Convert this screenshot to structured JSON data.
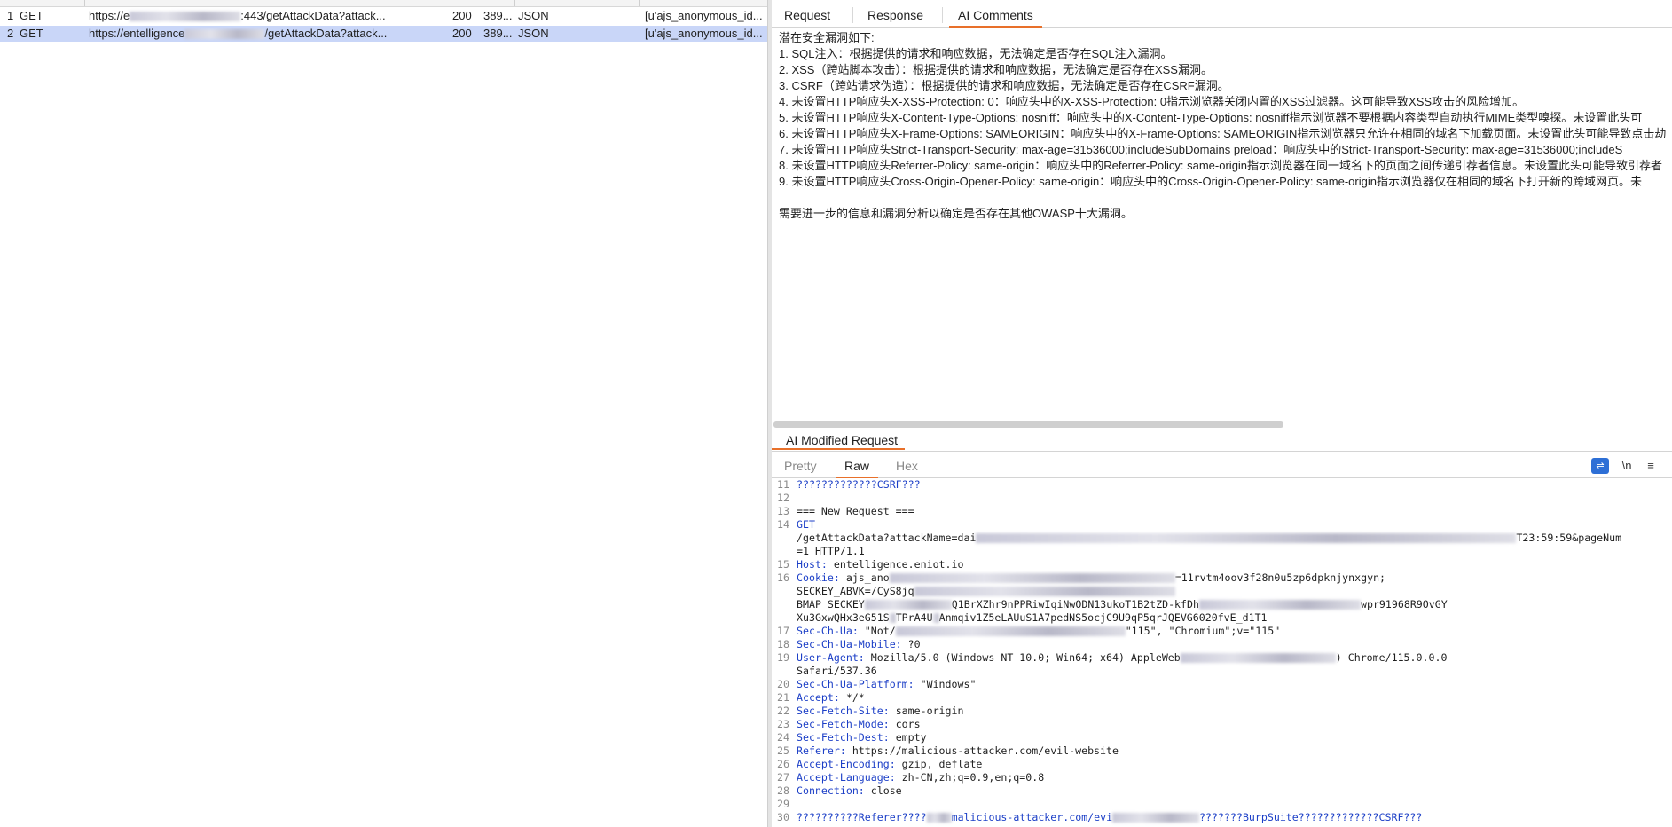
{
  "table": {
    "rows": [
      {
        "num": "1",
        "method": "GET",
        "url_prefix": "https://e",
        "url_suffix": ":443/getAttackData?attack...",
        "status": "200",
        "length": "389...",
        "mime": "JSON",
        "cookie": "[u'ajs_anonymous_id..."
      },
      {
        "num": "2",
        "method": "GET",
        "url_prefix": "https://entelligence",
        "url_suffix": "/getAttackData?attack...",
        "status": "200",
        "length": "389...",
        "mime": "JSON",
        "cookie": "[u'ajs_anonymous_id..."
      }
    ]
  },
  "right_tabs": [
    "Request",
    "Response",
    "AI Comments"
  ],
  "active_tab": "AI Comments",
  "ai_comments": {
    "lines": [
      "潜在安全漏洞如下:",
      "1. SQL注入：根据提供的请求和响应数据，无法确定是否存在SQL注入漏洞。",
      "2. XSS（跨站脚本攻击）：根据提供的请求和响应数据，无法确定是否存在XSS漏洞。",
      "3. CSRF（跨站请求伪造）：根据提供的请求和响应数据，无法确定是否存在CSRF漏洞。",
      "4. 未设置HTTP响应头X-XSS-Protection: 0：响应头中的X-XSS-Protection: 0指示浏览器关闭内置的XSS过滤器。这可能导致XSS攻击的风险增加。",
      "5. 未设置HTTP响应头X-Content-Type-Options: nosniff：响应头中的X-Content-Type-Options: nosniff指示浏览器不要根据内容类型自动执行MIME类型嗅探。未设置此头可",
      "6. 未设置HTTP响应头X-Frame-Options: SAMEORIGIN：响应头中的X-Frame-Options: SAMEORIGIN指示浏览器只允许在相同的域名下加载页面。未设置此头可能导致点击劫",
      "7. 未设置HTTP响应头Strict-Transport-Security: max-age=31536000;includeSubDomains preload：响应头中的Strict-Transport-Security: max-age=31536000;includeS",
      "8. 未设置HTTP响应头Referrer-Policy: same-origin：响应头中的Referrer-Policy: same-origin指示浏览器在同一域名下的页面之间传递引荐者信息。未设置此头可能导致引荐者",
      "9. 未设置HTTP响应头Cross-Origin-Opener-Policy: same-origin：响应头中的Cross-Origin-Opener-Policy: same-origin指示浏览器仅在相同的域名下打开新的跨域网页。未",
      "",
      "需要进一步的信息和漏洞分析以确定是否存在其他OWASP十大漏洞。"
    ]
  },
  "modified_request": {
    "title": "AI Modified Request",
    "subtabs": [
      "Pretty",
      "Raw",
      "Hex"
    ],
    "active_subtab": "Raw",
    "tools": [
      "wrap-icon",
      "\\n",
      "≡"
    ],
    "lines": [
      {
        "n": "11",
        "parts": [
          {
            "c": "q",
            "t": "?????????????CSRF???"
          }
        ]
      },
      {
        "n": "12",
        "parts": []
      },
      {
        "n": "13",
        "parts": [
          {
            "c": "txt",
            "t": "=== New Request ==="
          }
        ]
      },
      {
        "n": "14",
        "parts": [
          {
            "c": "kw",
            "t": "GET"
          }
        ]
      },
      {
        "n": "",
        "parts": [
          {
            "c": "txt",
            "t": "/getAttackData?attackName=dai"
          },
          {
            "c": "blur",
            "t": "                                                                                       "
          },
          {
            "c": "txt",
            "t": "T23:59:59&pageNum"
          }
        ]
      },
      {
        "n": "",
        "parts": [
          {
            "c": "txt",
            "t": "=1 HTTP/1.1"
          }
        ]
      },
      {
        "n": "15",
        "parts": [
          {
            "c": "kw",
            "t": "Host: "
          },
          {
            "c": "txt",
            "t": "entelligence.eniot.io"
          }
        ]
      },
      {
        "n": "16",
        "parts": [
          {
            "c": "kw",
            "t": "Cookie: "
          },
          {
            "c": "txt",
            "t": "ajs_ano"
          },
          {
            "c": "blur",
            "t": "                                              "
          },
          {
            "c": "txt",
            "t": "=11rvtm4oov3f28n0u5zp6dpknjynxgyn;"
          }
        ]
      },
      {
        "n": "",
        "parts": [
          {
            "c": "txt",
            "t": "SECKEY_ABVK=/CyS8jq"
          },
          {
            "c": "blur",
            "t": "                                          "
          }
        ]
      },
      {
        "n": "",
        "parts": [
          {
            "c": "txt",
            "t": "BMAP_SECKEY"
          },
          {
            "c": "blur",
            "t": "              "
          },
          {
            "c": "txt",
            "t": "Q1BrXZhr9nPPRiwIqiNwODN13ukoT1B2tZD-kfDh"
          },
          {
            "c": "blur",
            "t": "                          "
          },
          {
            "c": "txt",
            "t": "wpr91968R9OvGY"
          }
        ]
      },
      {
        "n": "",
        "parts": [
          {
            "c": "txt",
            "t": "Xu3GxwQHx3eG51S"
          },
          {
            "c": "blur",
            "t": " "
          },
          {
            "c": "txt",
            "t": "TPrA4U"
          },
          {
            "c": "blur",
            "t": " "
          },
          {
            "c": "txt",
            "t": "Anmqiv1Z5eLAUuS1A7pedNS5ocjC9U9qP5qrJQEVG6020fvE_d1T1"
          }
        ]
      },
      {
        "n": "17",
        "parts": [
          {
            "c": "kw",
            "t": "Sec-Ch-Ua: "
          },
          {
            "c": "txt",
            "t": "\"Not/"
          },
          {
            "c": "blur",
            "t": "                                     "
          },
          {
            "c": "txt",
            "t": "\"115\", \"Chromium\";v=\"115\""
          }
        ]
      },
      {
        "n": "18",
        "parts": [
          {
            "c": "kw",
            "t": "Sec-Ch-Ua-Mobile: "
          },
          {
            "c": "txt",
            "t": "?0"
          }
        ]
      },
      {
        "n": "19",
        "parts": [
          {
            "c": "kw",
            "t": "User-Agent: "
          },
          {
            "c": "txt",
            "t": "Mozilla/5.0 (Windows NT 10.0; Win64; x64) AppleWeb"
          },
          {
            "c": "blur",
            "t": "                         "
          },
          {
            "c": "txt",
            "t": ") Chrome/115.0.0.0"
          }
        ]
      },
      {
        "n": "",
        "parts": [
          {
            "c": "txt",
            "t": "Safari/537.36"
          }
        ]
      },
      {
        "n": "20",
        "parts": [
          {
            "c": "kw",
            "t": "Sec-Ch-Ua-Platform: "
          },
          {
            "c": "txt",
            "t": "\"Windows\""
          }
        ]
      },
      {
        "n": "21",
        "parts": [
          {
            "c": "kw",
            "t": "Accept: "
          },
          {
            "c": "txt",
            "t": "*/*"
          }
        ]
      },
      {
        "n": "22",
        "parts": [
          {
            "c": "kw",
            "t": "Sec-Fetch-Site: "
          },
          {
            "c": "txt",
            "t": "same-origin"
          }
        ]
      },
      {
        "n": "23",
        "parts": [
          {
            "c": "kw",
            "t": "Sec-Fetch-Mode: "
          },
          {
            "c": "txt",
            "t": "cors"
          }
        ]
      },
      {
        "n": "24",
        "parts": [
          {
            "c": "kw",
            "t": "Sec-Fetch-Dest: "
          },
          {
            "c": "txt",
            "t": "empty"
          }
        ]
      },
      {
        "n": "25",
        "parts": [
          {
            "c": "kw",
            "t": "Referer: "
          },
          {
            "c": "txt",
            "t": "https://malicious-attacker.com/evil-website"
          }
        ]
      },
      {
        "n": "26",
        "parts": [
          {
            "c": "kw",
            "t": "Accept-Encoding: "
          },
          {
            "c": "txt",
            "t": "gzip, deflate"
          }
        ]
      },
      {
        "n": "27",
        "parts": [
          {
            "c": "kw",
            "t": "Accept-Language: "
          },
          {
            "c": "txt",
            "t": "zh-CN,zh;q=0.9,en;q=0.8"
          }
        ]
      },
      {
        "n": "28",
        "parts": [
          {
            "c": "kw",
            "t": "Connection: "
          },
          {
            "c": "txt",
            "t": "close"
          }
        ]
      },
      {
        "n": "29",
        "parts": []
      },
      {
        "n": "30",
        "parts": [
          {
            "c": "q",
            "t": "??????????Referer????"
          },
          {
            "c": "blur",
            "t": "    "
          },
          {
            "c": "q",
            "t": "malicious-attacker.com/evi"
          },
          {
            "c": "blur",
            "t": "              "
          },
          {
            "c": "q",
            "t": "???????BurpSuite?????????????CSRF???"
          }
        ]
      }
    ]
  }
}
